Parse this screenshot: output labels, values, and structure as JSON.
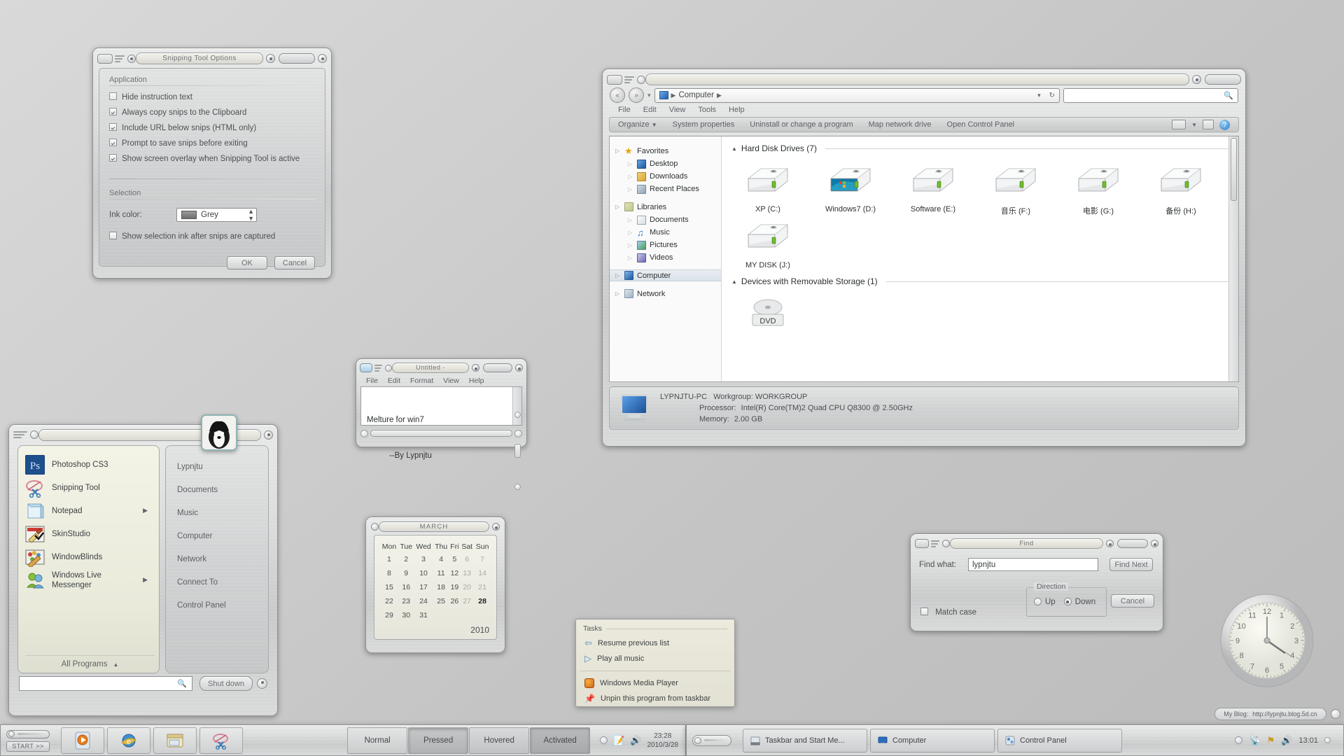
{
  "desktop": {
    "background_color": "#c9c9c9"
  },
  "snipping_options": {
    "title": "Snipping Tool Options",
    "group_application": "Application",
    "group_selection": "Selection",
    "options": [
      {
        "label": "Hide instruction text",
        "checked": false
      },
      {
        "label": "Always copy snips to the Clipboard",
        "checked": true
      },
      {
        "label": "Include URL below snips (HTML only)",
        "checked": true
      },
      {
        "label": "Prompt to save snips before exiting",
        "checked": true
      },
      {
        "label": "Show screen overlay when Snipping Tool is active",
        "checked": true
      }
    ],
    "ink_color_label": "Ink color:",
    "ink_color_value": "Grey",
    "show_selection_ink": {
      "label": "Show selection ink after snips are captured",
      "checked": false
    },
    "ok_label": "OK",
    "cancel_label": "Cancel"
  },
  "explorer": {
    "title": "",
    "breadcrumb": [
      "Computer"
    ],
    "search_placeholder": "",
    "menu": [
      "File",
      "Edit",
      "View",
      "Tools",
      "Help"
    ],
    "toolbar": [
      "Organize",
      "System properties",
      "Uninstall or change a program",
      "Map network drive",
      "Open Control Panel"
    ],
    "nav": [
      {
        "label": "Favorites",
        "icon": "star-icon",
        "level": 0
      },
      {
        "label": "Desktop",
        "icon": "desktop-icon",
        "level": 1
      },
      {
        "label": "Downloads",
        "icon": "downloads-icon",
        "level": 1
      },
      {
        "label": "Recent Places",
        "icon": "recent-places-icon",
        "level": 1
      },
      {
        "label": "Libraries",
        "icon": "libraries-icon",
        "level": 0
      },
      {
        "label": "Documents",
        "icon": "documents-icon",
        "level": 1
      },
      {
        "label": "Music",
        "icon": "music-icon",
        "level": 1
      },
      {
        "label": "Pictures",
        "icon": "pictures-icon",
        "level": 1
      },
      {
        "label": "Videos",
        "icon": "videos-icon",
        "level": 1
      },
      {
        "label": "Computer",
        "icon": "computer-icon",
        "level": 0,
        "selected": true
      },
      {
        "label": "Network",
        "icon": "network-icon",
        "level": 0
      }
    ],
    "section_hard_disks": "Hard Disk Drives (7)",
    "section_removable": "Devices with Removable Storage (1)",
    "drives": [
      {
        "label": "XP (C:)",
        "kind": "plain"
      },
      {
        "label": "Windows7 (D:)",
        "kind": "system"
      },
      {
        "label": "Software (E:)",
        "kind": "plain"
      },
      {
        "label": "音乐 (F:)",
        "kind": "plain"
      },
      {
        "label": "电影 (G:)",
        "kind": "plain"
      },
      {
        "label": "备份 (H:)",
        "kind": "plain"
      },
      {
        "label": "MY DISK (J:)",
        "kind": "plain"
      }
    ],
    "removable": [
      {
        "label": "DVD",
        "kind": "dvd"
      }
    ],
    "details": {
      "computer_name": "LYPNJTU-PC",
      "workgroup_label": "Workgroup:",
      "workgroup_value": "WORKGROUP",
      "processor_label": "Processor:",
      "processor_value": "Intel(R) Core(TM)2 Quad CPU    Q8300  @ 2.50GHz",
      "memory_label": "Memory:",
      "memory_value": "2.00 GB"
    }
  },
  "notepad": {
    "title": "Untitled -",
    "menu": [
      "File",
      "Edit",
      "Format",
      "View",
      "Help"
    ],
    "lines": [
      "Melture for win7",
      "          --By Lypnjtu"
    ]
  },
  "start_menu": {
    "programs": [
      {
        "label": "Photoshop CS3",
        "icon": "photoshop-icon",
        "arrow": false
      },
      {
        "label": "Snipping Tool",
        "icon": "snipping-tool-icon",
        "arrow": false
      },
      {
        "label": "Notepad",
        "icon": "notepad-icon",
        "arrow": true
      },
      {
        "label": "SkinStudio",
        "icon": "skinstudio-icon",
        "arrow": false
      },
      {
        "label": "WindowBlinds",
        "icon": "windowblinds-icon",
        "arrow": false
      },
      {
        "label": "Windows Live Messenger",
        "icon": "messenger-icon",
        "arrow": true
      }
    ],
    "all_programs": "All Programs",
    "places": [
      "Lypnjtu",
      "Documents",
      "Music",
      "Computer",
      "Network",
      "Connect To",
      "Control Panel"
    ],
    "search_value": "",
    "shutdown_label": "Shut down"
  },
  "calendar": {
    "month": "MARCH",
    "year": "2010",
    "weekdays": [
      "Mon",
      "Tue",
      "Wed",
      "Thu",
      "Fri",
      "Sat",
      "Sun"
    ],
    "weeks": [
      [
        "1",
        "2",
        "3",
        "4",
        "5",
        "6",
        "7"
      ],
      [
        "8",
        "9",
        "10",
        "11",
        "12",
        "13",
        "14"
      ],
      [
        "15",
        "16",
        "17",
        "18",
        "19",
        "20",
        "21"
      ],
      [
        "22",
        "23",
        "24",
        "25",
        "26",
        "27",
        "28"
      ],
      [
        "29",
        "30",
        "31",
        "",
        "",
        "",
        ""
      ]
    ],
    "today": "28",
    "weekend_columns": [
      5,
      6
    ]
  },
  "find_dialog": {
    "title": "Find",
    "find_what_label": "Find what:",
    "find_what_value": "lypnjtu",
    "direction_label": "Direction",
    "up_label": "Up",
    "down_label": "Down",
    "direction_selected": "Down",
    "match_case_label": "Match case",
    "match_case_checked": false,
    "find_next_label": "Find Next",
    "cancel_label": "Cancel"
  },
  "jumplist": {
    "header": "Tasks",
    "tasks": [
      {
        "label": "Resume previous list",
        "icon": "back-arrow-icon"
      },
      {
        "label": "Play all music",
        "icon": "play-icon"
      }
    ],
    "pinned": [
      {
        "label": "Windows Media Player",
        "icon": "wmp-icon"
      },
      {
        "label": "Unpin this program from taskbar",
        "icon": "unpin-icon"
      }
    ]
  },
  "blog_watermark": {
    "label": "My Blog:",
    "url": "http://lypnjtu.blog.5d.cn"
  },
  "clock_widget": {
    "numerals": [
      "12",
      "1",
      "2",
      "3",
      "4",
      "5",
      "6",
      "7",
      "8",
      "9",
      "10",
      "11"
    ],
    "time": "13:01"
  },
  "taskbar_left": {
    "start_label": "START >>",
    "quicklaunch": [
      {
        "icon": "windows-media-player-icon",
        "name": "windows-media-player"
      },
      {
        "icon": "internet-explorer-icon",
        "name": "internet-explorer"
      },
      {
        "icon": "explorer-folder-icon",
        "name": "windows-explorer"
      },
      {
        "icon": "snipping-tool-icon",
        "name": "snipping-tool"
      }
    ],
    "state_buttons": [
      "Normal",
      "Pressed",
      "Hovered",
      "Activated"
    ],
    "tray_time": "23:28",
    "tray_date": "2010/3/28"
  },
  "taskbar_right": {
    "buttons": [
      {
        "label": "Taskbar and Start Me...",
        "icon": "taskbar-properties-icon"
      },
      {
        "label": "Computer",
        "icon": "computer-icon"
      },
      {
        "label": "Control Panel",
        "icon": "control-panel-icon"
      }
    ],
    "tray_time": "13:01"
  }
}
